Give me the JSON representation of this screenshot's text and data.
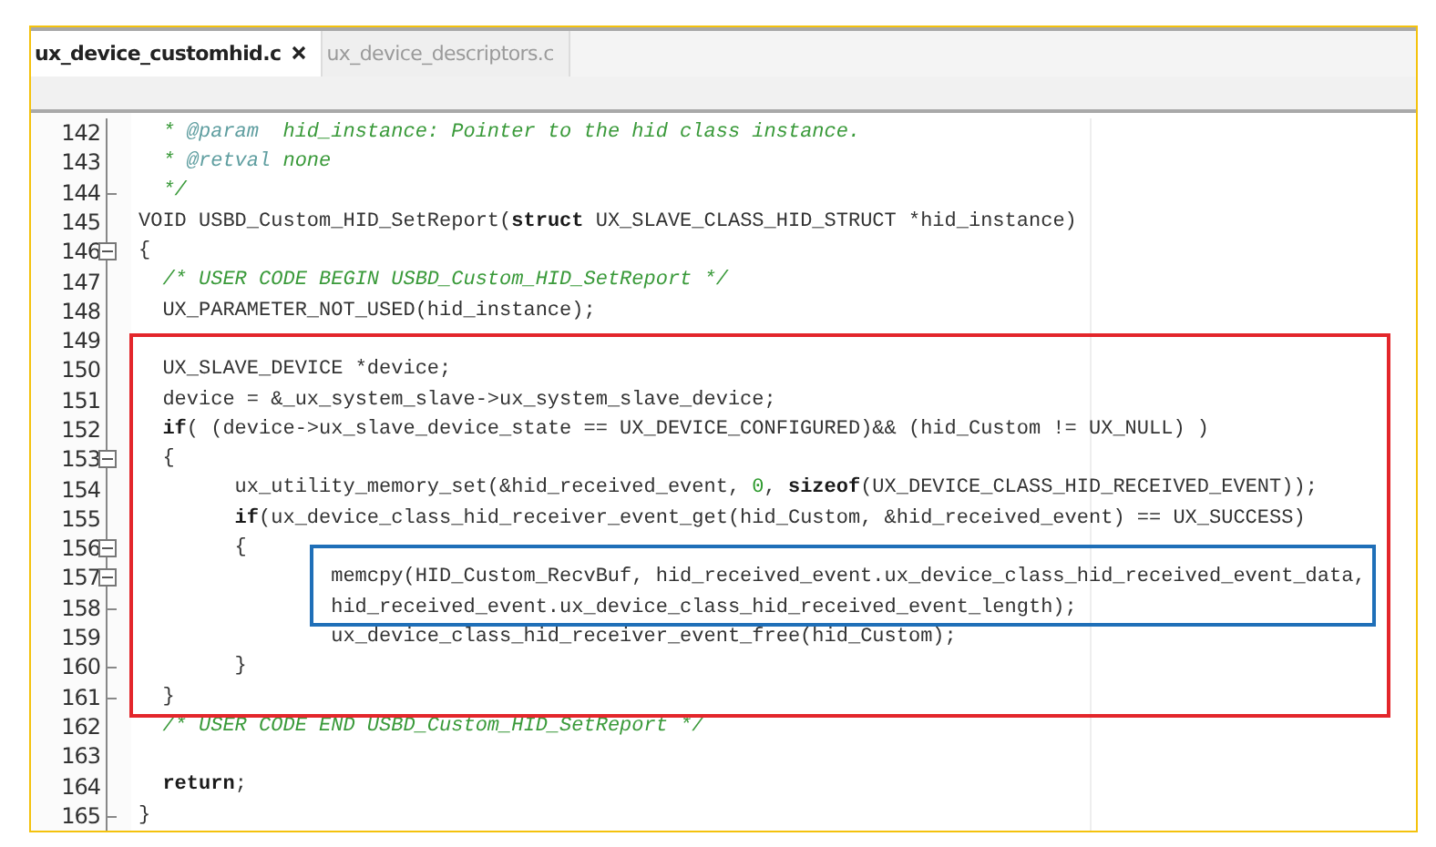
{
  "tabs": [
    {
      "label": "ux_device_customhid.c",
      "selected": true
    },
    {
      "label": "ux_device_descriptors.c",
      "selected": false
    }
  ],
  "editor": {
    "blocks": [
      {
        "kind": "line",
        "number": "142",
        "collapsible": false,
        "fold_end": false,
        "segments": [
          {
            "kind": "comment",
            "text": "  * "
          },
          {
            "kind": "doctag",
            "text": "@param"
          },
          {
            "kind": "comment",
            "text": "  hid_instance: Pointer to the hid class instance."
          }
        ]
      },
      {
        "kind": "line",
        "number": "143",
        "collapsible": false,
        "fold_end": false,
        "segments": [
          {
            "kind": "comment",
            "text": "  * "
          },
          {
            "kind": "doctag",
            "text": "@retval"
          },
          {
            "kind": "comment",
            "text": " none"
          }
        ]
      },
      {
        "kind": "line",
        "number": "144",
        "collapsible": false,
        "fold_end": true,
        "segments": [
          {
            "kind": "comment",
            "text": "  */"
          }
        ]
      },
      {
        "kind": "line",
        "number": "145",
        "collapsible": false,
        "fold_end": false,
        "segments": [
          {
            "kind": "plain",
            "text": "VOID USBD_Custom_HID_SetReport("
          },
          {
            "kind": "keyword",
            "text": "struct"
          },
          {
            "kind": "plain",
            "text": " UX_SLAVE_CLASS_HID_STRUCT *hid_instance)"
          }
        ]
      },
      {
        "kind": "line",
        "number": "146",
        "collapsible": true,
        "fold_end": false,
        "segments": [
          {
            "kind": "plain",
            "text": "{"
          }
        ]
      },
      {
        "kind": "line",
        "number": "147",
        "collapsible": false,
        "fold_end": false,
        "segments": [
          {
            "kind": "comment",
            "text": "  /* USER CODE BEGIN USBD_Custom_HID_SetReport */"
          }
        ]
      },
      {
        "kind": "line",
        "number": "148",
        "collapsible": false,
        "fold_end": false,
        "segments": [
          {
            "kind": "plain",
            "text": "  UX_PARAMETER_NOT_USED(hid_instance);"
          }
        ]
      },
      {
        "kind": "line",
        "number": "149",
        "collapsible": false,
        "fold_end": false
      },
      {
        "kind": "frame",
        "color": "#e3262b",
        "children": [
          {
            "kind": "line",
            "number": "150",
            "collapsible": false,
            "fold_end": false,
            "segments": [
              {
                "kind": "plain",
                "text": "  UX_SLAVE_DEVICE *device;"
              }
            ]
          },
          {
            "kind": "line",
            "number": "151",
            "collapsible": false,
            "fold_end": false,
            "segments": [
              {
                "kind": "plain",
                "text": "  device = &_ux_system_slave->ux_system_slave_device;"
              }
            ]
          },
          {
            "kind": "line",
            "number": "152",
            "collapsible": false,
            "fold_end": false,
            "segments": [
              {
                "kind": "keyword",
                "text": "  if"
              },
              {
                "kind": "plain",
                "text": "( (device->ux_slave_device_state == UX_DEVICE_CONFIGURED)&& (hid_Custom != UX_NULL) )"
              }
            ]
          },
          {
            "kind": "line",
            "number": "153",
            "collapsible": true,
            "fold_end": false,
            "segments": [
              {
                "kind": "plain",
                "text": "  {"
              }
            ]
          },
          {
            "kind": "line",
            "number": "154",
            "collapsible": false,
            "fold_end": false,
            "segments": [
              {
                "kind": "plain",
                "text": "        ux_utility_memory_set(&hid_received_event, "
              },
              {
                "kind": "number",
                "text": "0"
              },
              {
                "kind": "plain",
                "text": ", "
              },
              {
                "kind": "keyword",
                "text": "sizeof"
              },
              {
                "kind": "plain",
                "text": "(UX_DEVICE_CLASS_HID_RECEIVED_EVENT));"
              }
            ]
          },
          {
            "kind": "line",
            "number": "155",
            "collapsible": false,
            "fold_end": false,
            "segments": [
              {
                "kind": "keyword",
                "text": "        if"
              },
              {
                "kind": "plain",
                "text": "(ux_device_class_hid_receiver_event_get(hid_Custom, &hid_received_event) == UX_SUCCESS)"
              }
            ]
          },
          {
            "kind": "line",
            "number": "156",
            "collapsible": true,
            "fold_end": false,
            "segments": [
              {
                "kind": "plain",
                "text": "        {"
              }
            ]
          },
          {
            "kind": "frame",
            "color": "#1f6fb8",
            "children": [
              {
                "kind": "line",
                "number": "157",
                "collapsible": true,
                "fold_end": false,
                "segments": [
                  {
                    "kind": "plain",
                    "text": "memcpy(HID_Custom_RecvBuf, hid_received_event.ux_device_class_hid_received_event_data,"
                  }
                ]
              },
              {
                "kind": "line",
                "number": "158",
                "collapsible": false,
                "fold_end": true,
                "segments": [
                  {
                    "kind": "plain",
                    "text": "hid_received_event.ux_device_class_hid_received_event_length);"
                  }
                ]
              }
            ]
          },
          {
            "kind": "line",
            "number": "159",
            "collapsible": false,
            "fold_end": false,
            "segments": [
              {
                "kind": "plain",
                "text": "                ux_device_class_hid_receiver_event_free(hid_Custom);"
              }
            ]
          },
          {
            "kind": "line",
            "number": "160",
            "collapsible": false,
            "fold_end": true,
            "segments": [
              {
                "kind": "plain",
                "text": "        }"
              }
            ]
          },
          {
            "kind": "line",
            "number": "161",
            "collapsible": false,
            "fold_end": true,
            "segments": [
              {
                "kind": "plain",
                "text": "  }"
              }
            ]
          }
        ]
      },
      {
        "kind": "line",
        "number": "162",
        "collapsible": false,
        "fold_end": false,
        "segments": [
          {
            "kind": "comment",
            "text": "  /* USER CODE END USBD_Custom_HID_SetReport */"
          }
        ]
      },
      {
        "kind": "line",
        "number": "163",
        "collapsible": false,
        "fold_end": false
      },
      {
        "kind": "line",
        "number": "164",
        "collapsible": false,
        "fold_end": false,
        "segments": [
          {
            "kind": "keyword",
            "text": "  return"
          },
          {
            "kind": "plain",
            "text": ";"
          }
        ]
      },
      {
        "kind": "line",
        "number": "165",
        "collapsible": false,
        "fold_end": true,
        "segments": [
          {
            "kind": "plain",
            "text": "}"
          }
        ]
      }
    ]
  }
}
